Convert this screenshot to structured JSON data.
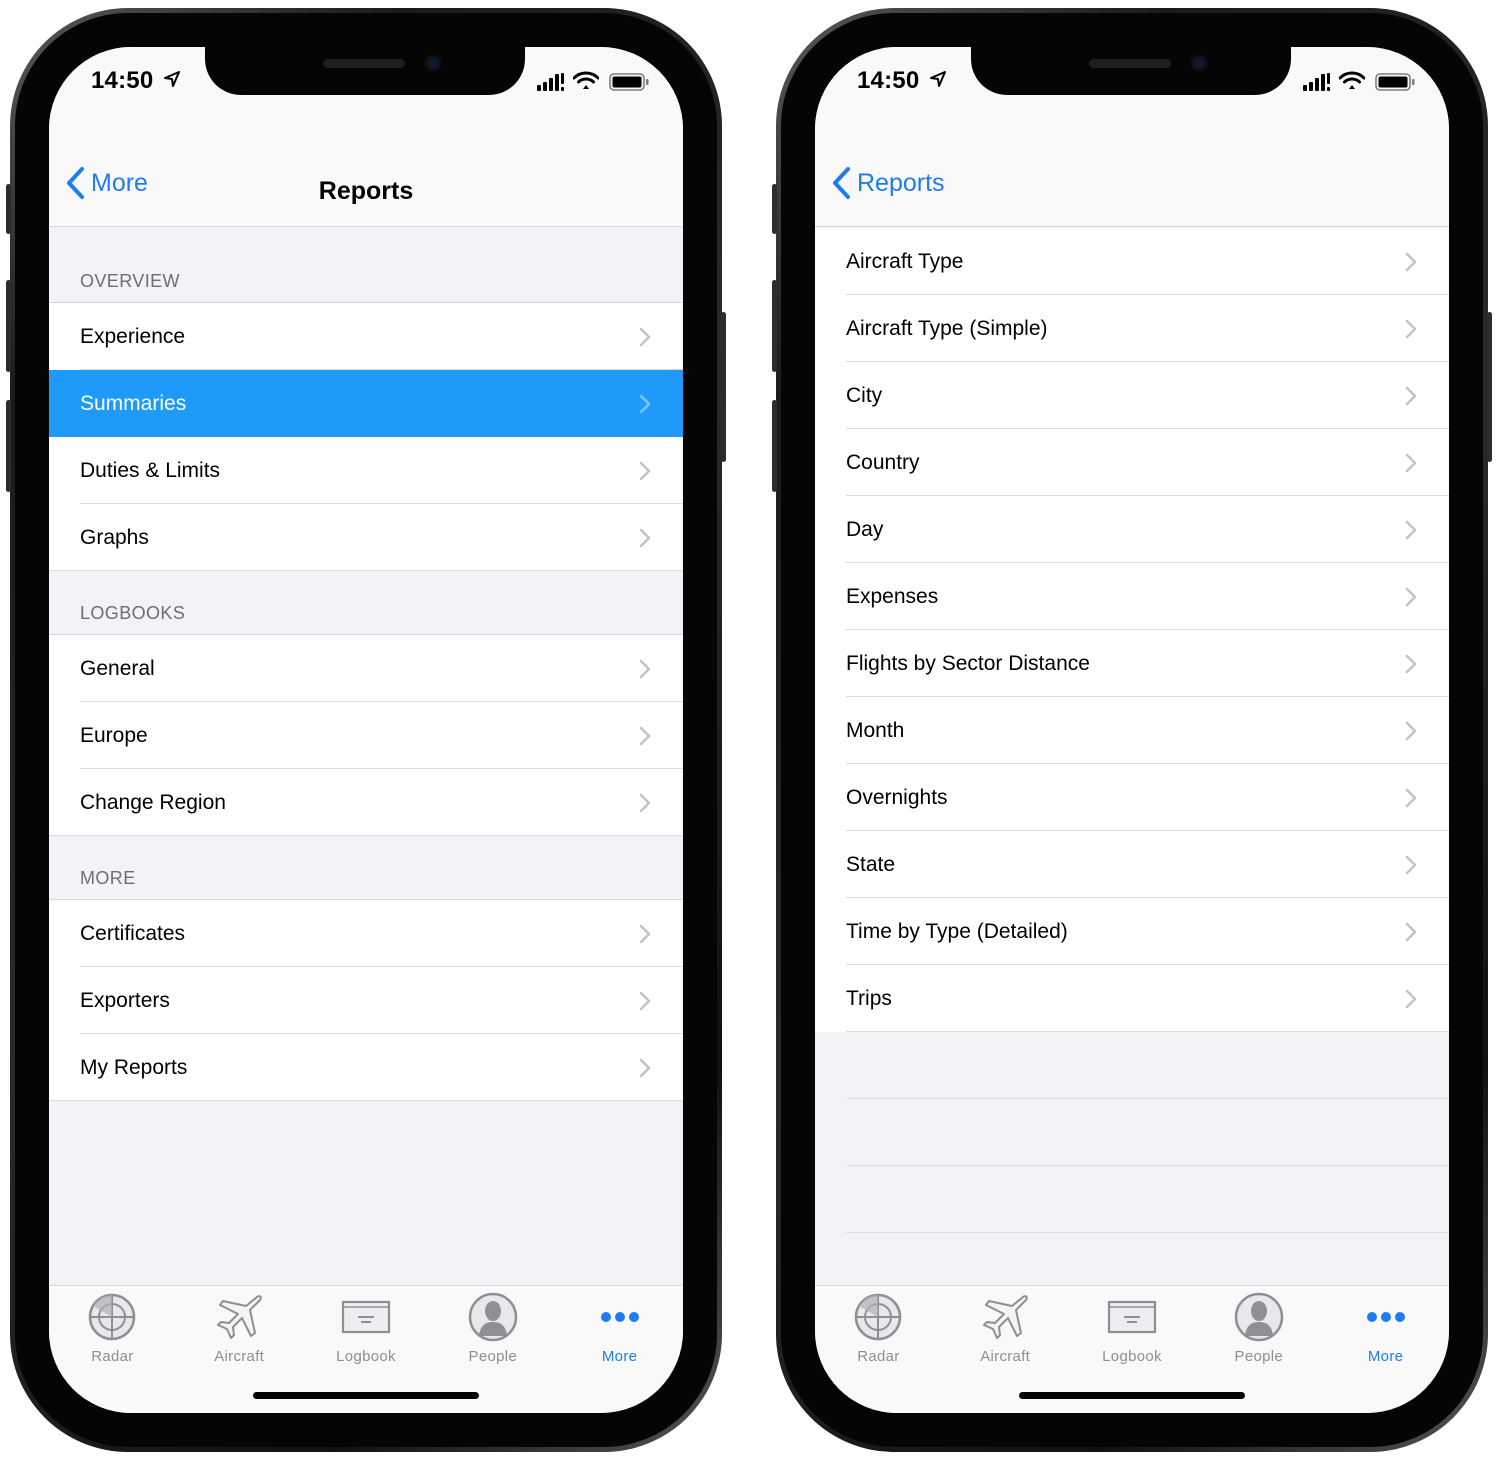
{
  "status": {
    "time": "14:50"
  },
  "colors": {
    "accent": "#1f7cf0",
    "selected_row": "#1e9bfa",
    "tab_inactive": "#8e8e93"
  },
  "left_screen": {
    "nav": {
      "back_label": "More",
      "title": "Reports"
    },
    "sections": [
      {
        "header": "OVERVIEW",
        "rows": [
          "Experience",
          "Summaries",
          "Duties & Limits",
          "Graphs"
        ],
        "selected_index": 1
      },
      {
        "header": "LOGBOOKS",
        "rows": [
          "General",
          "Europe",
          "Change Region"
        ]
      },
      {
        "header": "MORE",
        "rows": [
          "Certificates",
          "Exporters",
          "My Reports"
        ]
      }
    ]
  },
  "right_screen": {
    "nav": {
      "back_label": "Reports",
      "title": ""
    },
    "rows": [
      "Aircraft Type",
      "Aircraft Type (Simple)",
      "City",
      "Country",
      "Day",
      "Expenses",
      "Flights by Sector Distance",
      "Month",
      "Overnights",
      "State",
      "Time by Type (Detailed)",
      "Trips"
    ]
  },
  "tabbar": {
    "items": [
      {
        "label": "Radar",
        "icon": "radar-icon"
      },
      {
        "label": "Aircraft",
        "icon": "airplane-icon"
      },
      {
        "label": "Logbook",
        "icon": "logbook-icon"
      },
      {
        "label": "People",
        "icon": "person-icon"
      },
      {
        "label": "More",
        "icon": "more-dots-icon",
        "active": true
      }
    ]
  }
}
